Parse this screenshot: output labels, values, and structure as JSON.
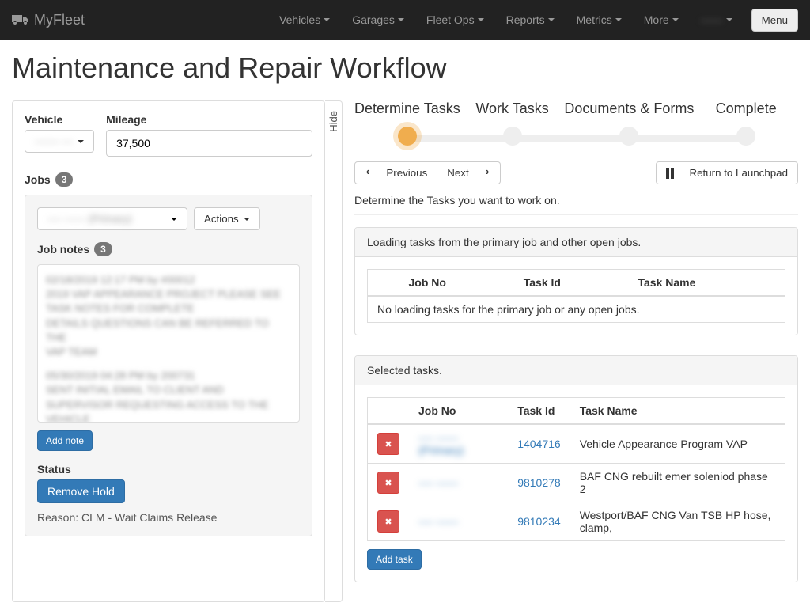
{
  "navbar": {
    "brand": "MyFleet",
    "items": [
      "Vehicles",
      "Garages",
      "Fleet Ops",
      "Reports",
      "Metrics",
      "More"
    ],
    "user": "------",
    "menu": "Menu"
  },
  "page_title": "Maintenance and Repair Workflow",
  "left": {
    "vehicle_label": "Vehicle",
    "vehicle_value": "------- ---",
    "mileage_label": "Mileage",
    "mileage_value": "37,500",
    "jobs_label": "Jobs",
    "jobs_count": "3",
    "job_select": "---- ------ (Primary)",
    "actions": "Actions",
    "notes_label": "Job notes",
    "notes_count": "3",
    "add_note": "Add note",
    "status_label": "Status",
    "remove_hold": "Remove Hold",
    "reason": "Reason:  CLM - Wait Claims Release"
  },
  "hide": "Hide",
  "steps": {
    "s1": "Determine Tasks",
    "s2": "Work Tasks",
    "s3": "Documents & Forms",
    "s4": "Complete"
  },
  "nav": {
    "previous": "Previous",
    "next": "Next",
    "return": "Return to Launchpad"
  },
  "instruction": "Determine the Tasks you want to work on.",
  "loading_panel": {
    "heading": "Loading tasks from the primary job and other open jobs.",
    "col_jobno": "Job No",
    "col_taskid": "Task Id",
    "col_taskname": "Task Name",
    "empty": "No loading tasks for the primary job or any open jobs."
  },
  "selected_panel": {
    "heading": "Selected tasks.",
    "col_jobno": "Job No",
    "col_taskid": "Task Id",
    "col_taskname": "Task Name",
    "rows": [
      {
        "jobno": "---- ------ (Primary)",
        "taskid": "1404716",
        "taskname": "Vehicle Appearance Program VAP"
      },
      {
        "jobno": "---- ------",
        "taskid": "9810278",
        "taskname": "BAF CNG rebuilt emer soleniod phase 2"
      },
      {
        "jobno": "---- ------",
        "taskid": "9810234",
        "taskname": "Westport/BAF CNG Van TSB HP hose, clamp,"
      }
    ],
    "add_task": "Add task"
  }
}
